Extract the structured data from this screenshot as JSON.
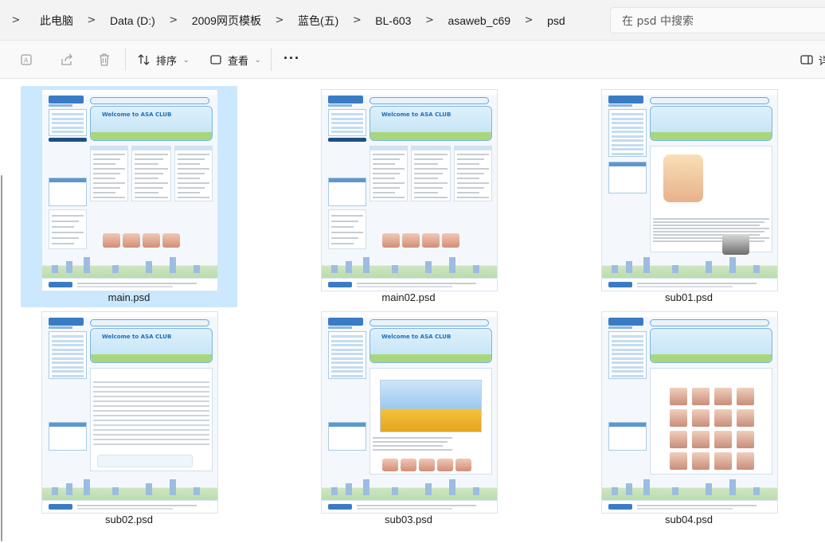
{
  "address": {
    "segments": [
      "此电脑",
      "Data (D:)",
      "2009网页模板",
      "蓝色(五)",
      "BL-603",
      "asaweb_c69",
      "psd"
    ],
    "search_placeholder": "在 psd 中搜索"
  },
  "toolbar": {
    "sort_label": "排序",
    "view_label": "查看",
    "more_label": "···",
    "details_label": "详"
  },
  "files": [
    {
      "name": "main.psd",
      "selected": true
    },
    {
      "name": "main02.psd",
      "selected": false
    },
    {
      "name": "sub01.psd",
      "selected": false
    },
    {
      "name": "sub02.psd",
      "selected": false
    },
    {
      "name": "sub03.psd",
      "selected": false
    },
    {
      "name": "sub04.psd",
      "selected": false
    }
  ],
  "thumb_text": {
    "welcome": "Welcome to ASA CLUB"
  },
  "colors": {
    "selection": "#cce8ff",
    "accent": "#3a7cc4"
  }
}
